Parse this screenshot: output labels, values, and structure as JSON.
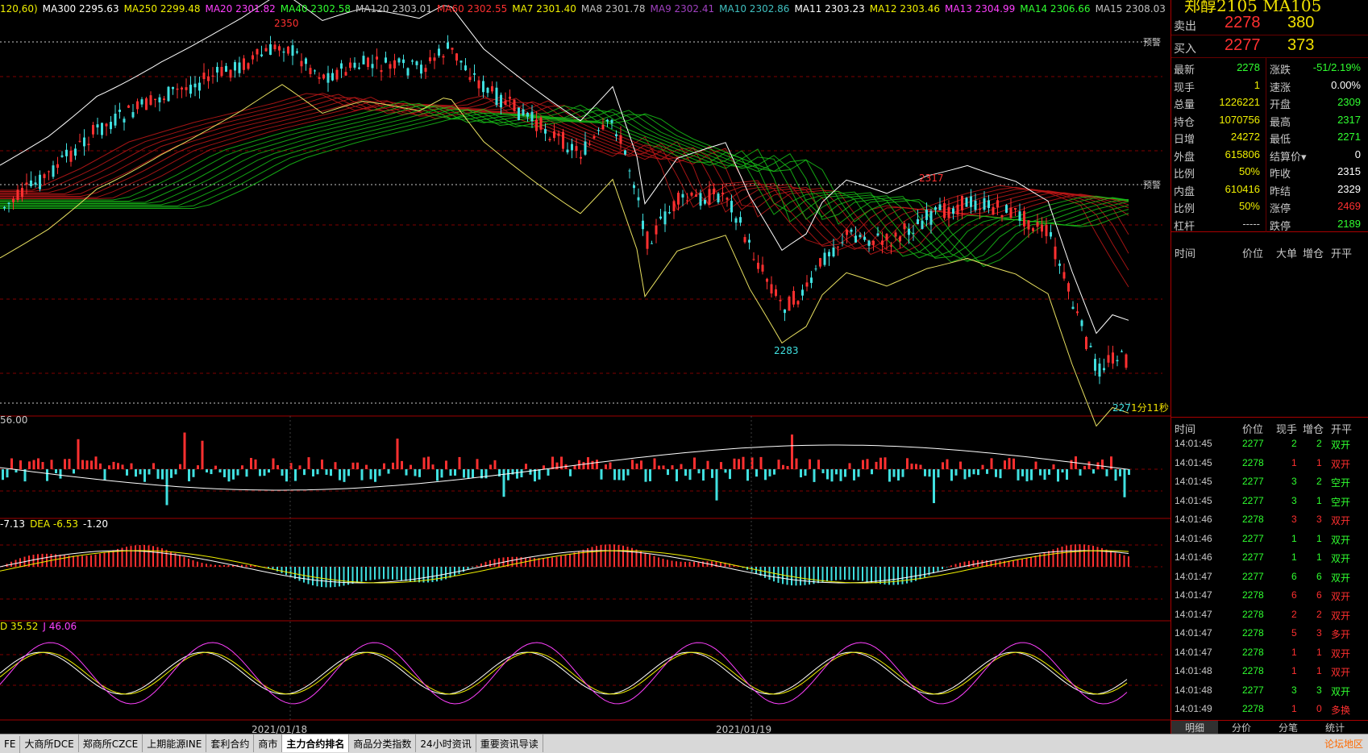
{
  "ma_line": [
    {
      "text": "120,60)",
      "color": "#f0f000"
    },
    {
      "text": "MA300 2295.63",
      "color": "#ffffff"
    },
    {
      "text": "MA250 2299.48",
      "color": "#f0f000"
    },
    {
      "text": "MA20 2301.82",
      "color": "#ff40ff"
    },
    {
      "text": "MA40 2302.58",
      "color": "#30ff30"
    },
    {
      "text": "MA120 2303.01",
      "color": "#c0c0c0"
    },
    {
      "text": "MA60 2302.55",
      "color": "#ff3030"
    },
    {
      "text": "MA7 2301.40",
      "color": "#f0f000"
    },
    {
      "text": "MA8 2301.78",
      "color": "#c0c0c0"
    },
    {
      "text": "MA9 2302.41",
      "color": "#a040c0"
    },
    {
      "text": "MA10 2302.86",
      "color": "#40c0c0"
    },
    {
      "text": "MA11 2303.23",
      "color": "#ffffff"
    },
    {
      "text": "MA12 2303.46",
      "color": "#f0f000"
    },
    {
      "text": "MA13 2304.99",
      "color": "#ff40ff"
    },
    {
      "text": "MA14 2306.66",
      "color": "#30ff30"
    },
    {
      "text": "MA15 2308.03",
      "color": "#c0c0c0"
    }
  ],
  "price_pane": {
    "high_label": "2350",
    "low_label_1": "2283",
    "mid_label": "2317",
    "last_low_label": "2271",
    "countdown": "1分11秒",
    "alert_label_1": "预警",
    "alert_label_2": "预警"
  },
  "volume_pane": {
    "label": "56.00"
  },
  "macd_pane": {
    "items": [
      {
        "text": "-7.13",
        "color": "#ffffff"
      },
      {
        "text": "DEA -6.53",
        "color": "#f0f000"
      },
      {
        "text": "-1.20",
        "color": "#ffffff"
      }
    ]
  },
  "kdj_pane": {
    "items": [
      {
        "text": "D 35.52",
        "color": "#f0f000"
      },
      {
        "text": "J 46.06",
        "color": "#ff40ff"
      }
    ]
  },
  "dates": [
    "2021/01/18",
    "2021/01/19"
  ],
  "side": {
    "title": "郑醇2105  MA105",
    "ask": {
      "label": "卖出",
      "price": "2278",
      "volume": "380"
    },
    "bid": {
      "label": "买入",
      "price": "2277",
      "volume": "373"
    },
    "quote": [
      {
        "l1": "最新",
        "v1": "2278",
        "c1": "#30ff30",
        "l2": "涨跌",
        "v2": "-51/2.19%",
        "c2": "#30ff30"
      },
      {
        "l1": "现手",
        "v1": "1",
        "c1": "#f0f000",
        "l2": "速涨",
        "v2": "0.00%",
        "c2": "#ffffff"
      },
      {
        "l1": "总量",
        "v1": "1226221",
        "c1": "#f0f000",
        "l2": "开盘",
        "v2": "2309",
        "c2": "#30ff30"
      },
      {
        "l1": "持仓",
        "v1": "1070756",
        "c1": "#f0f000",
        "l2": "最高",
        "v2": "2317",
        "c2": "#30ff30"
      },
      {
        "l1": "日增",
        "v1": "24272",
        "c1": "#f0f000",
        "l2": "最低",
        "v2": "2271",
        "c2": "#30ff30"
      },
      {
        "l1": "外盘",
        "v1": "615806",
        "c1": "#f0f000",
        "l2": "结算价▾",
        "v2": "0",
        "c2": "#ffffff"
      },
      {
        "l1": "比例",
        "v1": "50%",
        "c1": "#f0f000",
        "l2": "昨收",
        "v2": "2315",
        "c2": "#ffffff"
      },
      {
        "l1": "内盘",
        "v1": "610416",
        "c1": "#f0f000",
        "l2": "昨结",
        "v2": "2329",
        "c2": "#ffffff"
      },
      {
        "l1": "比例",
        "v1": "50%",
        "c1": "#f0f000",
        "l2": "涨停",
        "v2": "2469",
        "c2": "#ff3030"
      },
      {
        "l1": "杠杆",
        "v1": "-----",
        "c1": "#c8c8c8",
        "l2": "跌停",
        "v2": "2189",
        "c2": "#30ff30"
      }
    ],
    "bigorder_header": [
      "时间",
      "价位",
      "大单",
      "增仓",
      "开平"
    ],
    "trade_header": [
      "时间",
      "价位",
      "现手",
      "增仓",
      "开平"
    ],
    "trades": [
      {
        "time": "14:01:45",
        "price": "2277",
        "pc": "#30ff30",
        "vol": "2",
        "vc": "#30ff30",
        "inc": "2",
        "type": "双开",
        "tc": "#30ff30"
      },
      {
        "time": "14:01:45",
        "price": "2278",
        "pc": "#30ff30",
        "vol": "1",
        "vc": "#ff3030",
        "inc": "1",
        "type": "双开",
        "tc": "#ff3030"
      },
      {
        "time": "14:01:45",
        "price": "2277",
        "pc": "#30ff30",
        "vol": "3",
        "vc": "#30ff30",
        "inc": "2",
        "type": "空开",
        "tc": "#30ff30"
      },
      {
        "time": "14:01:45",
        "price": "2277",
        "pc": "#30ff30",
        "vol": "3",
        "vc": "#30ff30",
        "inc": "1",
        "type": "空开",
        "tc": "#30ff30"
      },
      {
        "time": "14:01:46",
        "price": "2278",
        "pc": "#30ff30",
        "vol": "3",
        "vc": "#ff3030",
        "inc": "3",
        "type": "双开",
        "tc": "#ff3030"
      },
      {
        "time": "14:01:46",
        "price": "2277",
        "pc": "#30ff30",
        "vol": "1",
        "vc": "#30ff30",
        "inc": "1",
        "type": "双开",
        "tc": "#30ff30"
      },
      {
        "time": "14:01:46",
        "price": "2277",
        "pc": "#30ff30",
        "vol": "1",
        "vc": "#30ff30",
        "inc": "1",
        "type": "双开",
        "tc": "#30ff30"
      },
      {
        "time": "14:01:47",
        "price": "2277",
        "pc": "#30ff30",
        "vol": "6",
        "vc": "#30ff30",
        "inc": "6",
        "type": "双开",
        "tc": "#30ff30"
      },
      {
        "time": "14:01:47",
        "price": "2278",
        "pc": "#30ff30",
        "vol": "6",
        "vc": "#ff3030",
        "inc": "6",
        "type": "双开",
        "tc": "#ff3030"
      },
      {
        "time": "14:01:47",
        "price": "2278",
        "pc": "#30ff30",
        "vol": "2",
        "vc": "#ff3030",
        "inc": "2",
        "type": "双开",
        "tc": "#ff3030"
      },
      {
        "time": "14:01:47",
        "price": "2278",
        "pc": "#30ff30",
        "vol": "5",
        "vc": "#ff3030",
        "inc": "3",
        "type": "多开",
        "tc": "#ff3030"
      },
      {
        "time": "14:01:47",
        "price": "2278",
        "pc": "#30ff30",
        "vol": "1",
        "vc": "#ff3030",
        "inc": "1",
        "type": "双开",
        "tc": "#ff3030"
      },
      {
        "time": "14:01:48",
        "price": "2278",
        "pc": "#30ff30",
        "vol": "1",
        "vc": "#ff3030",
        "inc": "1",
        "type": "双开",
        "tc": "#ff3030"
      },
      {
        "time": "14:01:48",
        "price": "2277",
        "pc": "#30ff30",
        "vol": "3",
        "vc": "#30ff30",
        "inc": "3",
        "type": "双开",
        "tc": "#30ff30"
      },
      {
        "time": "14:01:49",
        "price": "2278",
        "pc": "#30ff30",
        "vol": "1",
        "vc": "#ff3030",
        "inc": "0",
        "type": "多换",
        "tc": "#ff3030"
      }
    ],
    "tabs": [
      "明细",
      "分价",
      "分笔",
      "统计"
    ]
  },
  "bottom_tabs": [
    "FE",
    "大商所DCE",
    "郑商所CZCE",
    "上期能源INE",
    "套利合约",
    "商市",
    "主力合约排名",
    "商品分类指数",
    "24小时资讯",
    "重要资讯导读"
  ],
  "bottom_active": "主力合约排名",
  "forum_label": "论坛地区",
  "colors": {
    "up": "#ff3030",
    "down": "#40e0e0",
    "grid": "#800000"
  }
}
